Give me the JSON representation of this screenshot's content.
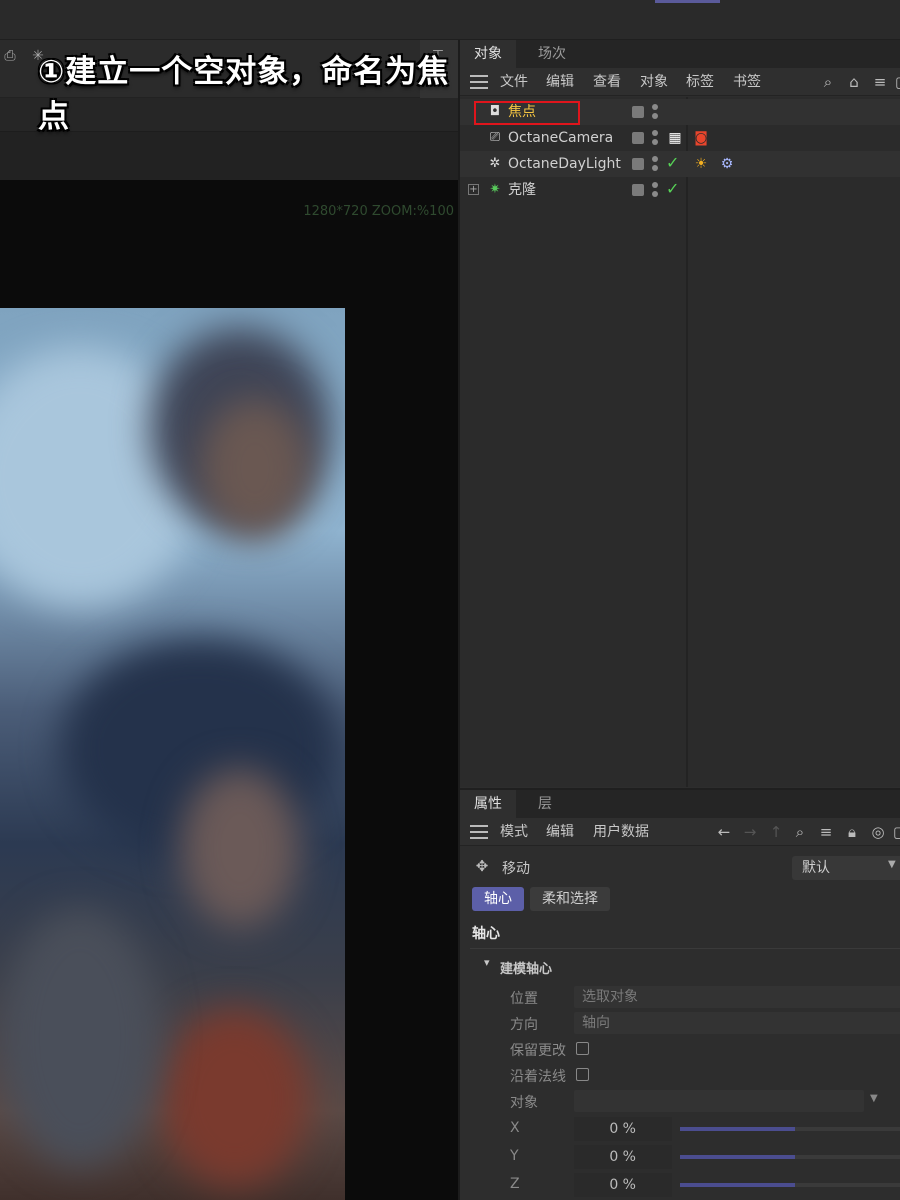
{
  "caption": "①建立一个空对象，命名为焦点",
  "viewport": {
    "status": "1280*720 ZOOM:%100"
  },
  "object_manager": {
    "tabs": [
      "对象",
      "场次"
    ],
    "menu": [
      "文件",
      "编辑",
      "查看",
      "对象",
      "标签",
      "书签"
    ],
    "objects": [
      {
        "name": "焦点",
        "icon": "null-object-icon",
        "selected": true
      },
      {
        "name": "OctaneCamera",
        "icon": "camera-icon",
        "tag": "octane-camera-tag-icon"
      },
      {
        "name": "OctaneDayLight",
        "icon": "light-icon",
        "check": "✓",
        "tag": "sun-tag-icon"
      },
      {
        "name": "克隆",
        "icon": "cloner-icon",
        "check": "✓",
        "expand": "+"
      }
    ]
  },
  "attributes": {
    "tabs": [
      "属性",
      "层"
    ],
    "menu": [
      "模式",
      "编辑",
      "用户数据"
    ],
    "tool": "移动",
    "preset": "默认",
    "pills": [
      "轴心",
      "柔和选择"
    ],
    "section_title": "轴心",
    "group_title": "建模轴心",
    "fields": {
      "position_label": "位置",
      "position_value": "选取对象",
      "direction_label": "方向",
      "direction_value": "轴向",
      "keep_label": "保留更改",
      "normal_label": "沿着法线",
      "object_label": "对象"
    },
    "coords": [
      {
        "axis": "X",
        "value": "0 %",
        "fill": 0.52
      },
      {
        "axis": "Y",
        "value": "0 %",
        "fill": 0.52
      },
      {
        "axis": "Z",
        "value": "0 %",
        "fill": 0.52
      }
    ]
  },
  "colors": {
    "selection": "#e0151c",
    "active_tab": "#5c5fa8",
    "selected_name": "#f4c542"
  }
}
